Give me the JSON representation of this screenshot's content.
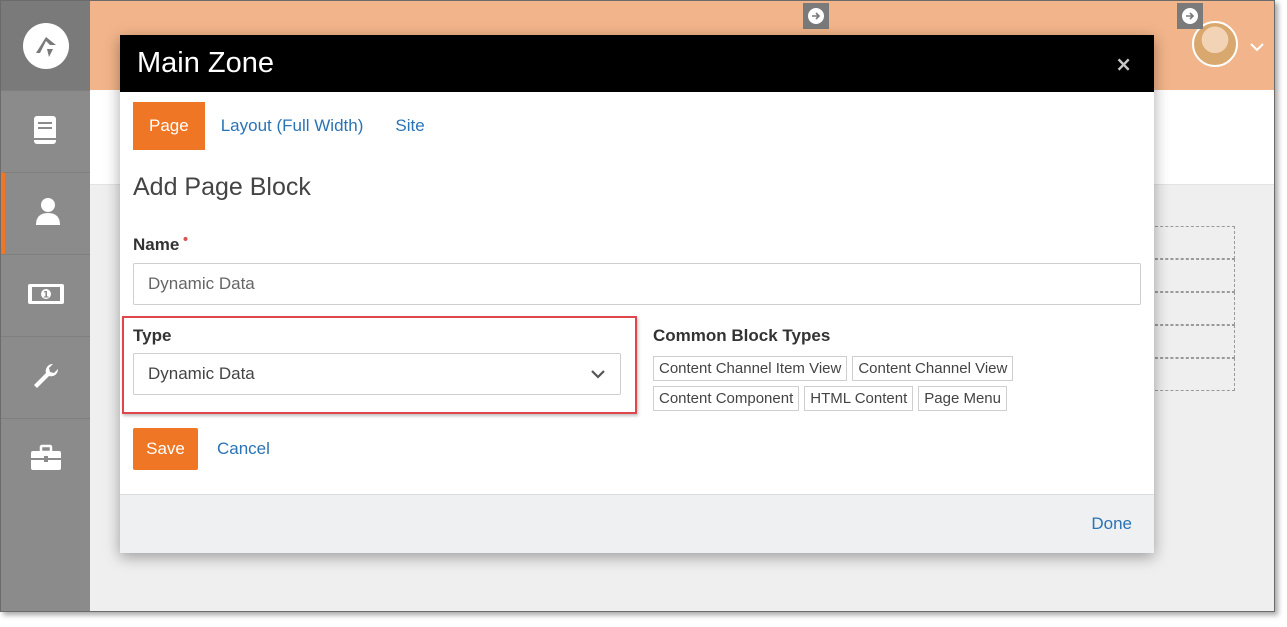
{
  "sidebar": {
    "logo": "rock-logo-icon",
    "items": [
      {
        "icon": "book-icon"
      },
      {
        "icon": "person-icon",
        "active": true
      },
      {
        "icon": "money-icon"
      },
      {
        "icon": "wrench-icon"
      },
      {
        "icon": "briefcase-icon"
      }
    ]
  },
  "header": {
    "avatar": "user-avatar"
  },
  "modal": {
    "title": "Main Zone",
    "close_glyph": "×",
    "tabs": [
      {
        "label": "Page",
        "active": true
      },
      {
        "label": "Layout (Full Width)",
        "active": false
      },
      {
        "label": "Site",
        "active": false
      }
    ],
    "section_title": "Add Page Block",
    "name": {
      "label": "Name",
      "required_marker": "•",
      "placeholder": "Dynamic Data"
    },
    "type": {
      "label": "Type",
      "selected": "Dynamic Data"
    },
    "common_block_types": {
      "label": "Common Block Types",
      "items": [
        "Content Channel Item View",
        "Content Channel View",
        "Content Component",
        "HTML Content",
        "Page Menu"
      ]
    },
    "save_label": "Save",
    "cancel_label": "Cancel",
    "done_label": "Done"
  },
  "colors": {
    "accent": "#ee7624",
    "header_bg": "#f2b48a",
    "sidebar_bg": "#8b8b8b",
    "link": "#2a73b5",
    "highlight": "#e0474c"
  }
}
